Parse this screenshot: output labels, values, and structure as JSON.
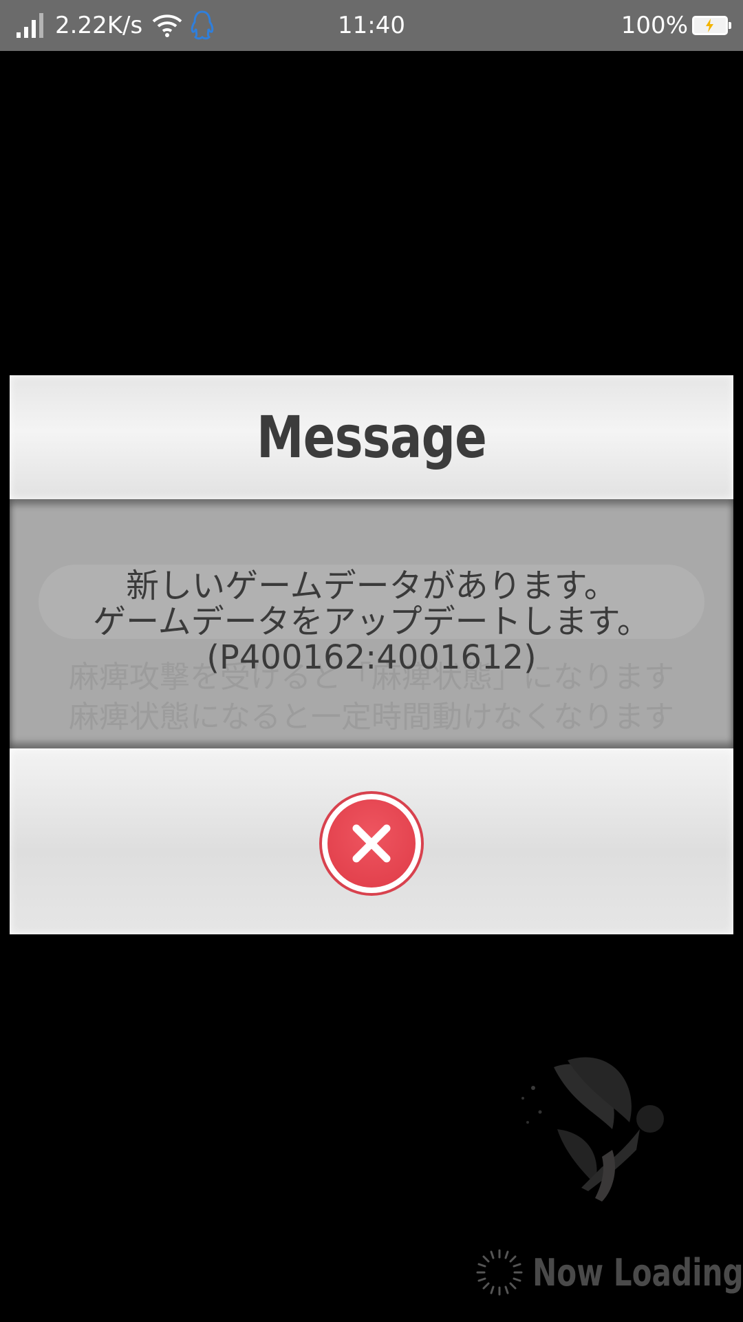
{
  "status_bar": {
    "net_speed": "2.22K/s",
    "time": "11:40",
    "battery_percent": "100%",
    "battery_level": 1.0,
    "icons": [
      "signal-icon",
      "wifi-icon",
      "qq-icon",
      "battery-charging-icon"
    ]
  },
  "dialog": {
    "title": "Message",
    "message_lines": [
      "新しいゲームデータがあります。",
      "ゲームデータをアップデートします。",
      "(P400162:4001612)"
    ],
    "background_text_lines": [
      "麻痺攻撃を受けると「麻痺状態」になります",
      "麻痺状態になると一定時間動けなくなります"
    ],
    "close_icon": "close-icon",
    "close_color": "#df3b47"
  },
  "loading": {
    "label": "Now Loading",
    "icon": "spinner-icon"
  }
}
